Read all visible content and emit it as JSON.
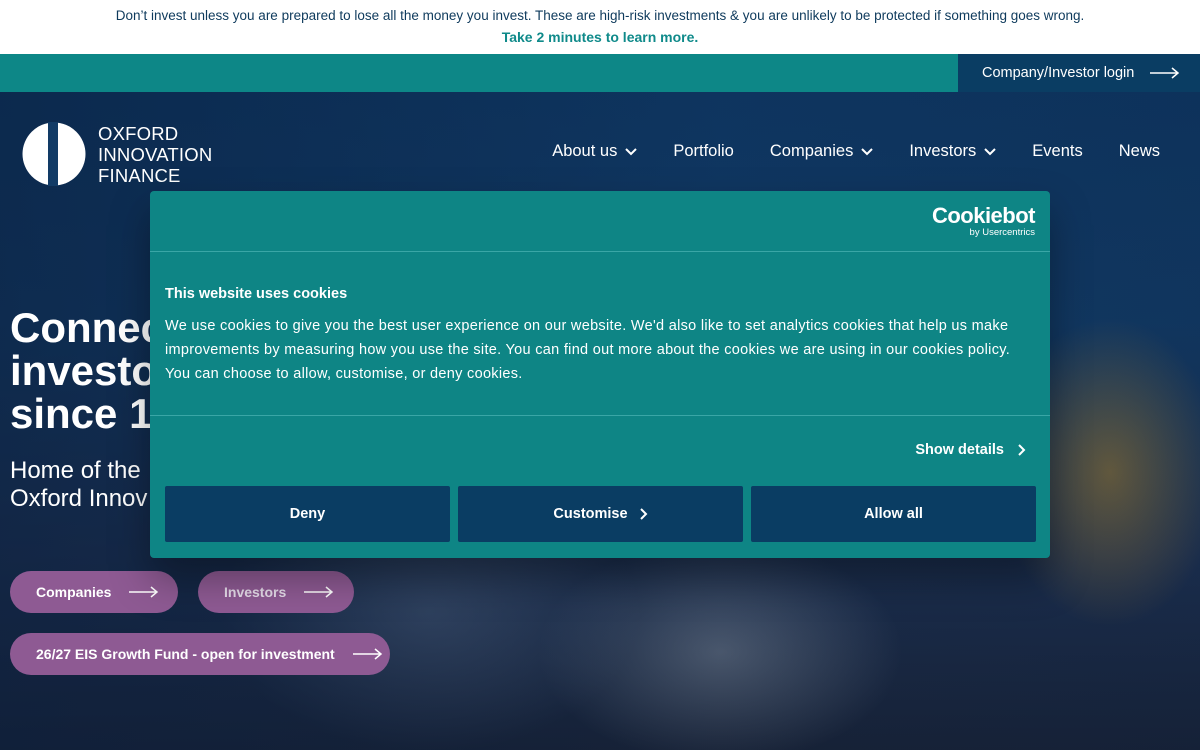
{
  "risk_banner": {
    "text": "Don’t invest unless you are prepared to lose all the money you invest. These are high-risk investments & you are unlikely to be protected if something goes wrong.",
    "link": "Take 2 minutes to learn more."
  },
  "utility": {
    "login_label": "Company/Investor login"
  },
  "logo": {
    "line1": "OXFORD",
    "line2": "INNOVATION",
    "line3": "FINANCE"
  },
  "nav": {
    "about": "About us",
    "portfolio": "Portfolio",
    "companies": "Companies",
    "investors": "Investors",
    "events": "Events",
    "news": "News"
  },
  "hero": {
    "title_line1": "Connecting",
    "title_line2": "investors",
    "title_line3": "since 1999",
    "sub_line1": "Home of the",
    "sub_line2": "Oxford Innov",
    "btn_companies": "Companies",
    "btn_investors": "Investors",
    "btn_eis": "26/27 EIS Growth Fund - open for investment"
  },
  "cookie": {
    "brand": "Cookiebot",
    "brand_sub": "by Usercentrics",
    "title": "This website uses cookies",
    "text": "We use cookies to give you the best user experience on our website. We'd also like to set analytics cookies that help us make improvements by measuring how you use the site. You can find out more about the cookies we are using in our cookies policy. You can choose to allow, customise, or deny cookies.",
    "show_details": "Show details",
    "deny": "Deny",
    "customise": "Customise",
    "allow_all": "Allow all"
  },
  "colors": {
    "teal": "#0d8787",
    "navy": "#0a3d63",
    "purple": "#8e5a93"
  }
}
